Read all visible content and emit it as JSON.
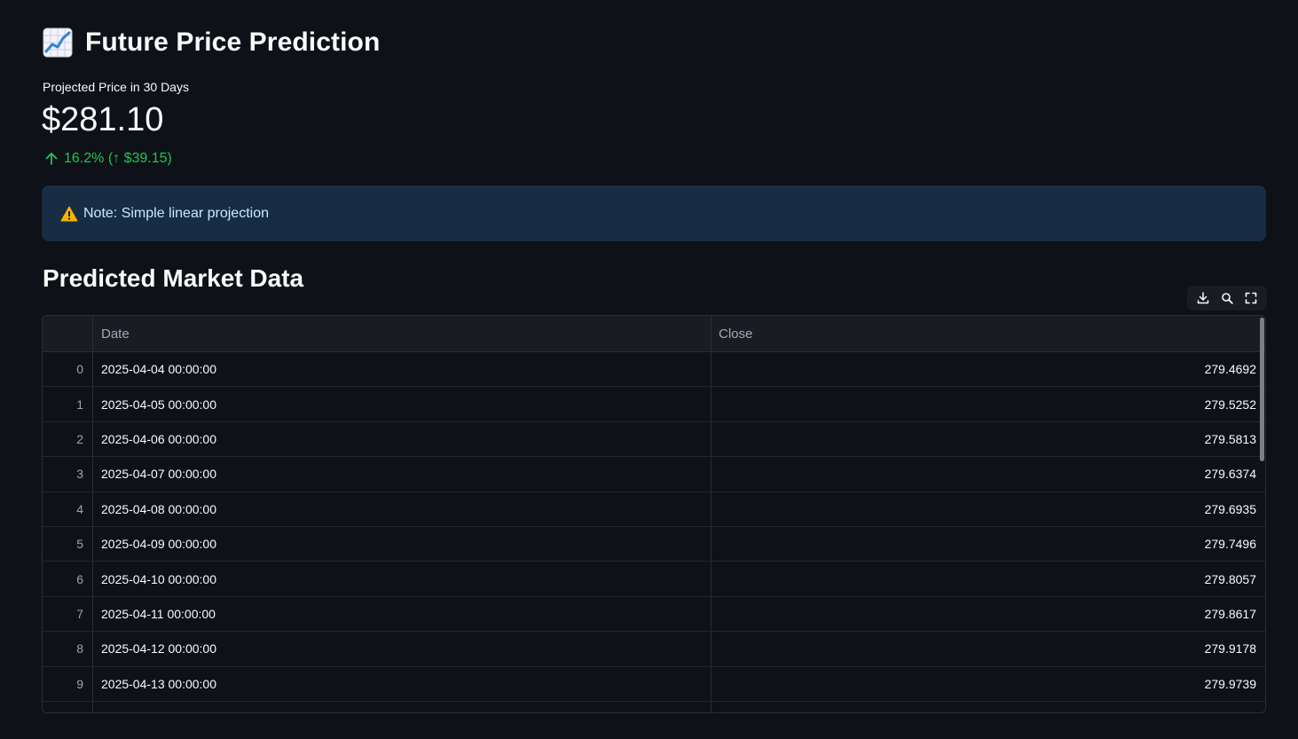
{
  "header": {
    "icon": "chart-increasing-emoji",
    "title": "Future Price Prediction"
  },
  "metric": {
    "label": "Projected Price in 30 Days",
    "value": "$281.10",
    "delta": "16.2% (↑ $39.15)",
    "delta_color": "#21c354"
  },
  "alert": {
    "icon": "warning-icon",
    "text": "Note: Simple linear projection",
    "background": "#172d43"
  },
  "section": {
    "title": "Predicted Market Data"
  },
  "toolbar": {
    "buttons": [
      "download-icon",
      "search-icon",
      "fullscreen-icon"
    ]
  },
  "table": {
    "columns": [
      "",
      "Date",
      "Close"
    ],
    "rows": [
      {
        "index": "0",
        "date": "2025-04-04 00:00:00",
        "close": "279.4692"
      },
      {
        "index": "1",
        "date": "2025-04-05 00:00:00",
        "close": "279.5252"
      },
      {
        "index": "2",
        "date": "2025-04-06 00:00:00",
        "close": "279.5813"
      },
      {
        "index": "3",
        "date": "2025-04-07 00:00:00",
        "close": "279.6374"
      },
      {
        "index": "4",
        "date": "2025-04-08 00:00:00",
        "close": "279.6935"
      },
      {
        "index": "5",
        "date": "2025-04-09 00:00:00",
        "close": "279.7496"
      },
      {
        "index": "6",
        "date": "2025-04-10 00:00:00",
        "close": "279.8057"
      },
      {
        "index": "7",
        "date": "2025-04-11 00:00:00",
        "close": "279.8617"
      },
      {
        "index": "8",
        "date": "2025-04-12 00:00:00",
        "close": "279.9178"
      },
      {
        "index": "9",
        "date": "2025-04-13 00:00:00",
        "close": "279.9739"
      },
      {
        "index": "",
        "date": "",
        "close": ""
      }
    ]
  }
}
